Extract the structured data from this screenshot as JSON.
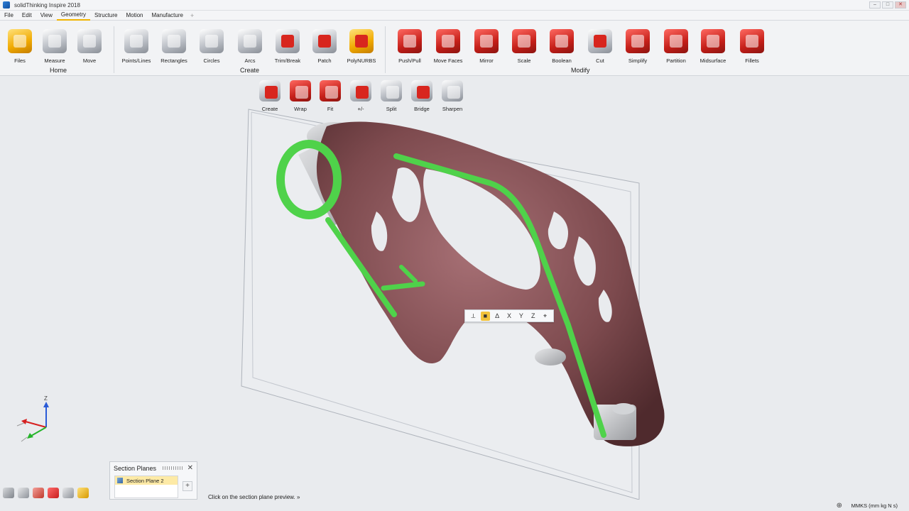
{
  "window": {
    "title": "solidThinking Inspire 2018"
  },
  "menu": {
    "items": [
      "File",
      "Edit",
      "View",
      "Geometry",
      "Structure",
      "Motion",
      "Manufacture"
    ],
    "active": "Geometry",
    "add_symbol": "+"
  },
  "ribbon": {
    "groups": {
      "home": {
        "label": "Home",
        "tools": [
          "Files",
          "Measure",
          "Move"
        ]
      },
      "create": {
        "label": "Create",
        "tools": [
          "Points/Lines",
          "Rectangles",
          "Circles",
          "Arcs",
          "Trim/Break",
          "Patch",
          "PolyNURBS"
        ]
      },
      "modify": {
        "label": "Modify",
        "tools": [
          "Push/Pull",
          "Move Faces",
          "Mirror",
          "Scale",
          "Boolean",
          "Cut",
          "Simplify",
          "Partition",
          "Midsurface",
          "Fillets"
        ]
      }
    },
    "subtools": [
      "Create",
      "Wrap",
      "Fit",
      "+/-",
      "Split",
      "Bridge",
      "Sharpen"
    ]
  },
  "microdialog": {
    "buttons": [
      "⟂",
      "■",
      "∆",
      "X",
      "Y",
      "Z",
      "⌖"
    ]
  },
  "triad": {
    "z": "Z"
  },
  "section_planes": {
    "title": "Section Planes",
    "close": "✕",
    "items": [
      "Section Plane 2"
    ],
    "add": "+"
  },
  "status": {
    "hint": "Click on the section plane preview. »",
    "units": "MMKS (mm kg N s)",
    "icon": "⊕"
  },
  "colors": {
    "model": "#7d4a4e",
    "section": "#4fd24a",
    "accent": "#f0b400"
  }
}
